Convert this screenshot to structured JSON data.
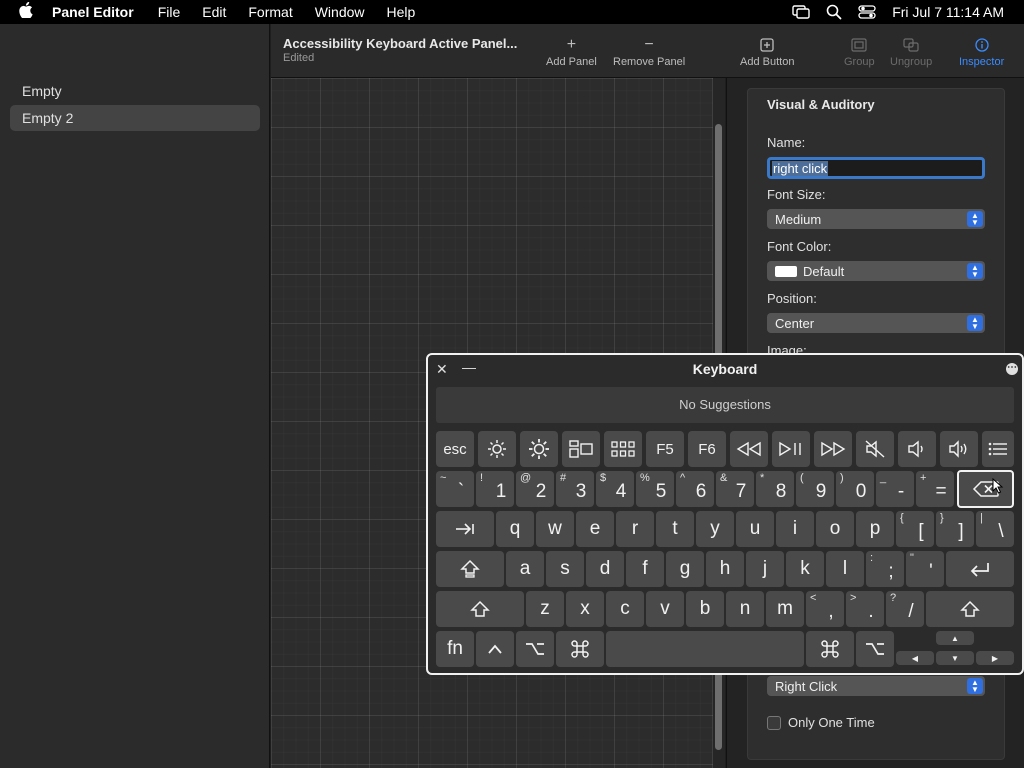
{
  "menubar": {
    "app_name": "Panel Editor",
    "menus": [
      "File",
      "Edit",
      "Format",
      "Window",
      "Help"
    ],
    "clock": "Fri Jul 7  11:14 AM"
  },
  "sidebar": {
    "items": [
      {
        "label": "Empty",
        "selected": false
      },
      {
        "label": "Empty 2",
        "selected": true
      }
    ]
  },
  "toolbar": {
    "title": "Accessibility Keyboard Active Panel...",
    "subtitle": "Edited",
    "add_panel": "Add Panel",
    "remove_panel": "Remove Panel",
    "add_button": "Add Button",
    "group": "Group",
    "ungroup": "Ungroup",
    "inspector": "Inspector"
  },
  "inspector": {
    "heading": "Visual & Auditory",
    "name_label": "Name:",
    "name_value": "right click",
    "font_size_label": "Font Size:",
    "font_size_value": "Medium",
    "font_color_label": "Font Color:",
    "font_color_value": "Default",
    "position_label": "Position:",
    "position_value": "Center",
    "image_label": "Image:",
    "action_value": "Right Click",
    "only_one_time": "Only One Time"
  },
  "keyboard": {
    "title": "Keyboard",
    "suggestions": "No Suggestions",
    "keys": {
      "esc": "esc",
      "f5": "F5",
      "f6": "F6",
      "fn": "fn",
      "n1": "1",
      "n2": "2",
      "n3": "3",
      "n4": "4",
      "n5": "5",
      "n6": "6",
      "n7": "7",
      "n8": "8",
      "n9": "9",
      "n0": "0",
      "s1": "!",
      "s2": "@",
      "s3": "#",
      "s4": "$",
      "s5": "%",
      "s6": "^",
      "s7": "&",
      "s8": "*",
      "s9": "(",
      "s0": ")",
      "grave": "`",
      "tilde": "~",
      "minus": "-",
      "underscore": "_",
      "equals": "=",
      "plus": "+",
      "q": "q",
      "w": "w",
      "e": "e",
      "r": "r",
      "t": "t",
      "y": "y",
      "u": "u",
      "i": "i",
      "o": "o",
      "p": "p",
      "lbracket": "[",
      "lbrace": "{",
      "rbracket": "]",
      "rbrace": "}",
      "backslash": "\\",
      "pipe": "|",
      "a": "a",
      "s": "s",
      "d": "d",
      "f": "f",
      "g": "g",
      "h": "h",
      "j": "j",
      "k": "k",
      "l": "l",
      "semicolon": ";",
      "colon": ":",
      "quote": "'",
      "dquote": "\"",
      "z": "z",
      "x": "x",
      "c": "c",
      "v": "v",
      "b": "b",
      "n": "n",
      "m": "m",
      "comma": ",",
      "lt": "<",
      "period": ".",
      "gt": ">",
      "slash": "/",
      "question": "?"
    }
  }
}
